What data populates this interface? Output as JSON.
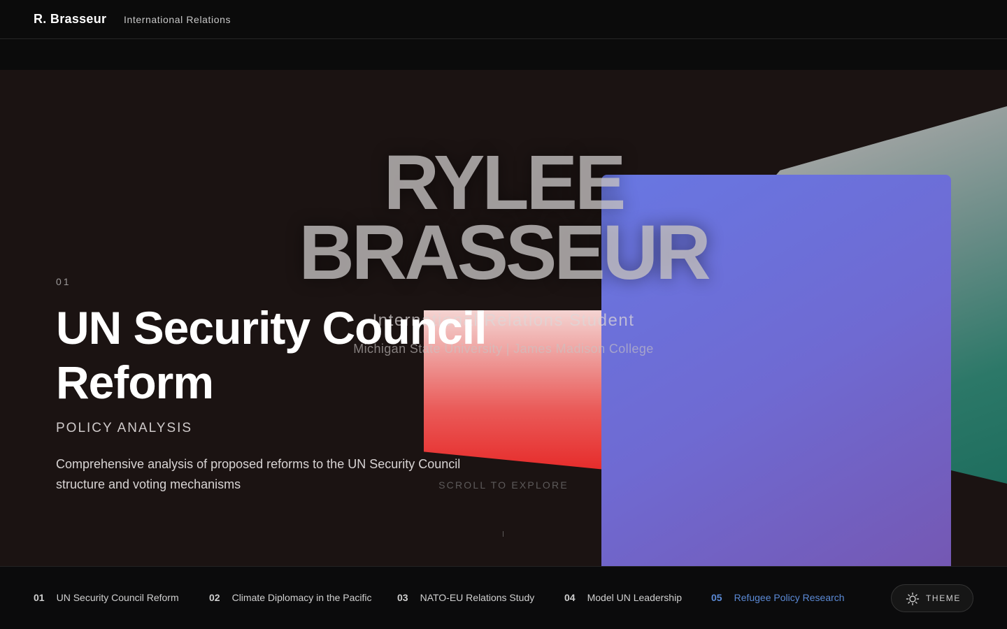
{
  "header": {
    "brand": "R. Brasseur",
    "subtitle": "International Relations"
  },
  "hero": {
    "name_line1": "RYLEE",
    "name_line2": "BRASSEUR",
    "role": "International Relations Student",
    "school": "Michigan State University | James Madison College",
    "scroll_hint": "SCROLL TO EXPLORE"
  },
  "project": {
    "number": "01",
    "title": "UN Security Council Reform",
    "category": "POLICY ANALYSIS",
    "description": "Comprehensive analysis of proposed reforms to the UN Security Council structure and voting mechanisms"
  },
  "nav": {
    "items": [
      {
        "num": "01",
        "label": "UN Security Council Reform"
      },
      {
        "num": "02",
        "label": "Climate Diplomacy in the Pacific"
      },
      {
        "num": "03",
        "label": "NATO-EU Relations Study"
      },
      {
        "num": "04",
        "label": "Model UN Leadership"
      },
      {
        "num": "05",
        "label": "Refugee Policy Research"
      }
    ],
    "active_index": 4
  },
  "theme_button": {
    "label": "THEME",
    "icon": "sun-icon"
  },
  "colors": {
    "background": "#0b0b0b",
    "stage": "#1b1312",
    "accent": "#5b8ad6",
    "purple": "#6f6ad2",
    "red": "#e62b2a",
    "teal": "#1e6e5e"
  }
}
